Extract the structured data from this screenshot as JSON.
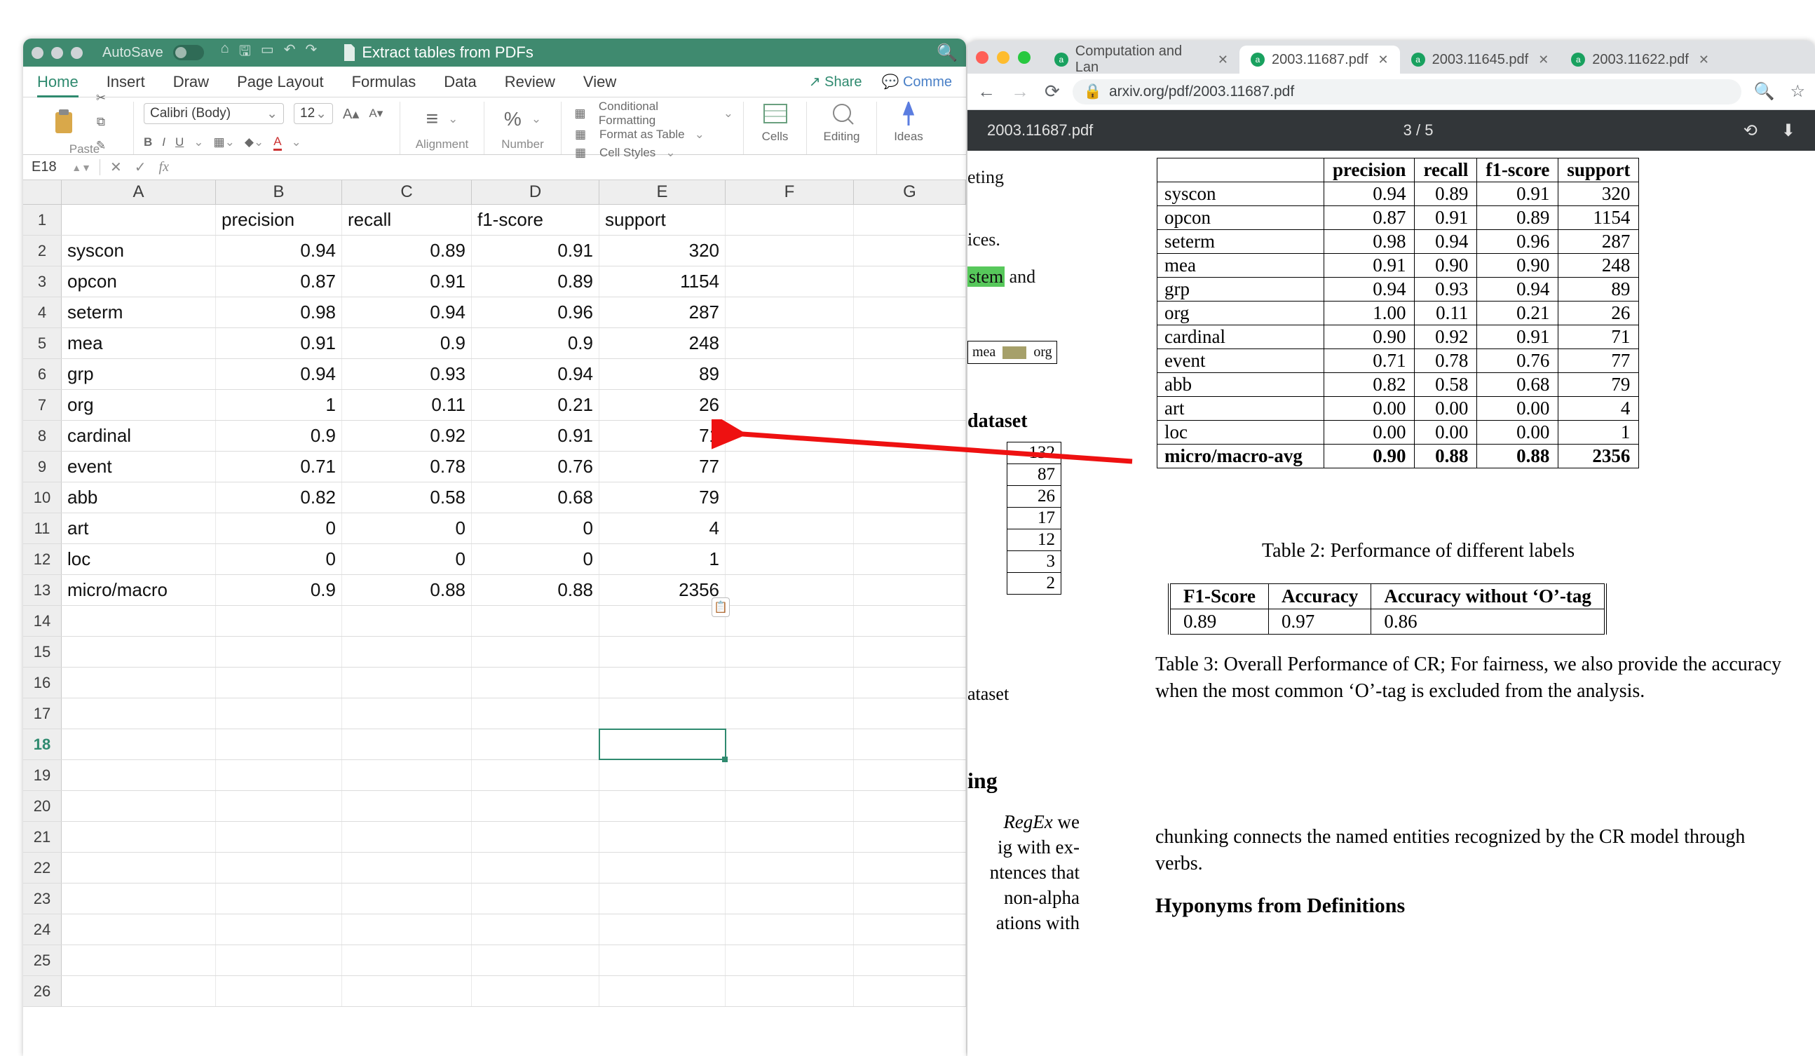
{
  "excel": {
    "autosave_label": "AutoSave",
    "doc_title": "Extract tables from PDFs",
    "menu": {
      "home": "Home",
      "insert": "Insert",
      "draw": "Draw",
      "layout": "Page Layout",
      "formulas": "Formulas",
      "data": "Data",
      "review": "Review",
      "view": "View",
      "share": "Share",
      "comments": "Comme"
    },
    "ribbon": {
      "paste": "Paste",
      "font": "Calibri (Body)",
      "font_size": "12",
      "alignment": "Alignment",
      "number": "Number",
      "cond": "Conditional Formatting",
      "fmt_table": "Format as Table",
      "cell_styles": "Cell Styles",
      "cells": "Cells",
      "editing": "Editing",
      "ideas": "Ideas"
    },
    "namebox": "E18",
    "columns": [
      "A",
      "B",
      "C",
      "D",
      "E",
      "F",
      "G"
    ],
    "row_count": 26,
    "active_row": 18,
    "headers": {
      "a": "",
      "b": "precision",
      "c": "recall",
      "d": "f1-score",
      "e": "support"
    },
    "rows": [
      {
        "a": "syscon",
        "b": "0.94",
        "c": "0.89",
        "d": "0.91",
        "e": "320"
      },
      {
        "a": "opcon",
        "b": "0.87",
        "c": "0.91",
        "d": "0.89",
        "e": "1154"
      },
      {
        "a": "seterm",
        "b": "0.98",
        "c": "0.94",
        "d": "0.96",
        "e": "287"
      },
      {
        "a": "mea",
        "b": "0.91",
        "c": "0.9",
        "d": "0.9",
        "e": "248"
      },
      {
        "a": "grp",
        "b": "0.94",
        "c": "0.93",
        "d": "0.94",
        "e": "89"
      },
      {
        "a": "org",
        "b": "1",
        "c": "0.11",
        "d": "0.21",
        "e": "26"
      },
      {
        "a": "cardinal",
        "b": "0.9",
        "c": "0.92",
        "d": "0.91",
        "e": "71"
      },
      {
        "a": "event",
        "b": "0.71",
        "c": "0.78",
        "d": "0.76",
        "e": "77"
      },
      {
        "a": "abb",
        "b": "0.82",
        "c": "0.58",
        "d": "0.68",
        "e": "79"
      },
      {
        "a": "art",
        "b": "0",
        "c": "0",
        "d": "0",
        "e": "4"
      },
      {
        "a": "loc",
        "b": "0",
        "c": "0",
        "d": "0",
        "e": "1"
      },
      {
        "a": "micro/macro",
        "b": "0.9",
        "c": "0.88",
        "d": "0.88",
        "e": "2356"
      }
    ]
  },
  "chrome": {
    "tabs": [
      {
        "label": "Computation and Lan",
        "active": false
      },
      {
        "label": "2003.11687.pdf",
        "active": true
      },
      {
        "label": "2003.11645.pdf",
        "active": false
      },
      {
        "label": "2003.11622.pdf",
        "active": false
      }
    ],
    "url": "arxiv.org/pdf/2003.11687.pdf",
    "viewer_title": "2003.11687.pdf",
    "page_indicator": "3 / 5"
  },
  "pdf": {
    "left_frag": {
      "l1": "eting",
      "l2": "ices.",
      "l3a": "stem",
      "l3b": " and",
      "leg_a": "mea",
      "leg_b": "org",
      "dataset": "dataset",
      "ataset": "ataset",
      "ing": "ing",
      "regex1": "RegEx we",
      "regex2": "ig with ex-",
      "regex3": "ntences that",
      "regex4": "non-alpha",
      "regex5": "ations  with"
    },
    "smallcol": [
      "132",
      "87",
      "26",
      "17",
      "12",
      "3",
      "2"
    ],
    "table2": {
      "head": [
        "",
        "precision",
        "recall",
        "f1-score",
        "support"
      ],
      "rows": [
        [
          "syscon",
          "0.94",
          "0.89",
          "0.91",
          "320"
        ],
        [
          "opcon",
          "0.87",
          "0.91",
          "0.89",
          "1154"
        ],
        [
          "seterm",
          "0.98",
          "0.94",
          "0.96",
          "287"
        ],
        [
          "mea",
          "0.91",
          "0.90",
          "0.90",
          "248"
        ],
        [
          "grp",
          "0.94",
          "0.93",
          "0.94",
          "89"
        ],
        [
          "org",
          "1.00",
          "0.11",
          "0.21",
          "26"
        ],
        [
          "cardinal",
          "0.90",
          "0.92",
          "0.91",
          "71"
        ],
        [
          "event",
          "0.71",
          "0.78",
          "0.76",
          "77"
        ],
        [
          "abb",
          "0.82",
          "0.58",
          "0.68",
          "79"
        ],
        [
          "art",
          "0.00",
          "0.00",
          "0.00",
          "4"
        ],
        [
          "loc",
          "0.00",
          "0.00",
          "0.00",
          "1"
        ]
      ],
      "avg": [
        "micro/macro-avg",
        "0.90",
        "0.88",
        "0.88",
        "2356"
      ],
      "caption": "Table 2: Performance of different labels"
    },
    "table3": {
      "head": [
        "F1-Score",
        "Accuracy",
        "Accuracy without ‘O’-tag"
      ],
      "row": [
        "0.89",
        "0.97",
        "0.86"
      ],
      "caption": "Table 3: Overall Performance of CR; For fairness, we also provide the accuracy when the most common ‘O’-tag is excluded from the analysis."
    },
    "chunk": "chunking connects the named entities recognized by the CR model through verbs.",
    "hyp": "Hyponyms from Definitions"
  }
}
